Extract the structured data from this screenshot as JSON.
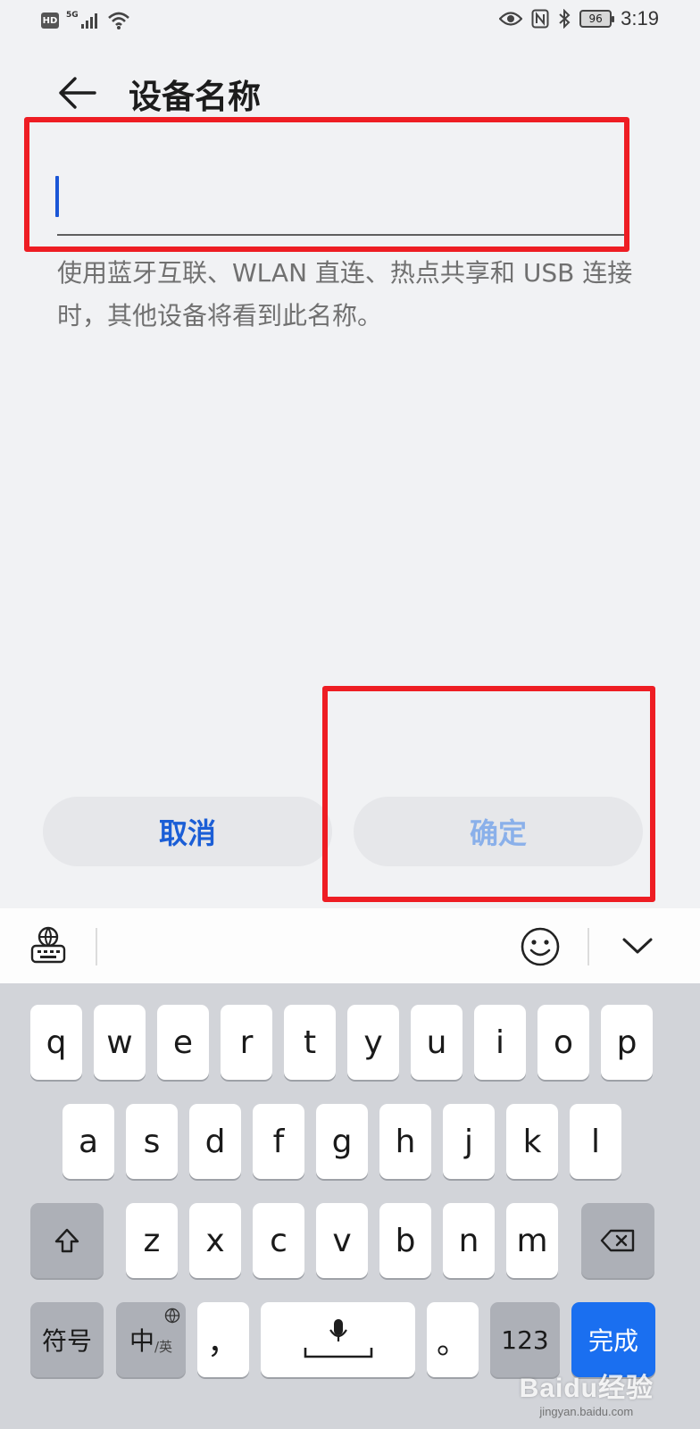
{
  "status_bar": {
    "hd_label": "HD",
    "network_label": "5G",
    "battery_percent": "96",
    "time": "3:19",
    "icons": [
      "signal-icon",
      "wifi-icon",
      "eye-icon",
      "nfc-icon",
      "bluetooth-icon",
      "battery-icon"
    ]
  },
  "header": {
    "title": "设备名称",
    "back_icon": "back-arrow-icon"
  },
  "name_field": {
    "value": "",
    "hint": "使用蓝牙互联、WLAN 直连、热点共享和 USB 连接时，其他设备将看到此名称。"
  },
  "buttons": {
    "cancel_label": "取消",
    "ok_label": "确定"
  },
  "colors": {
    "accent": "#1b5ed6",
    "disabled_accent": "#8ab0ea",
    "highlight": "#ee1d23",
    "done_key": "#1a6ff0"
  },
  "keyboard": {
    "toolbar_icons": [
      "keyboard-settings-icon",
      "emoji-icon",
      "chevron-down-icon"
    ],
    "row1": [
      "q",
      "w",
      "e",
      "r",
      "t",
      "y",
      "u",
      "i",
      "o",
      "p"
    ],
    "row2": [
      "a",
      "s",
      "d",
      "f",
      "g",
      "h",
      "j",
      "k",
      "l"
    ],
    "row3": [
      "z",
      "x",
      "c",
      "v",
      "b",
      "n",
      "m"
    ],
    "symbols_label": "符号",
    "lang_main": "中",
    "lang_sub": "/英",
    "comma_label": "，",
    "period_label": "。",
    "numbers_label": "123",
    "done_label": "完成"
  },
  "watermark": {
    "main": "Baidu经验",
    "url": "jingyan.baidu.com"
  }
}
